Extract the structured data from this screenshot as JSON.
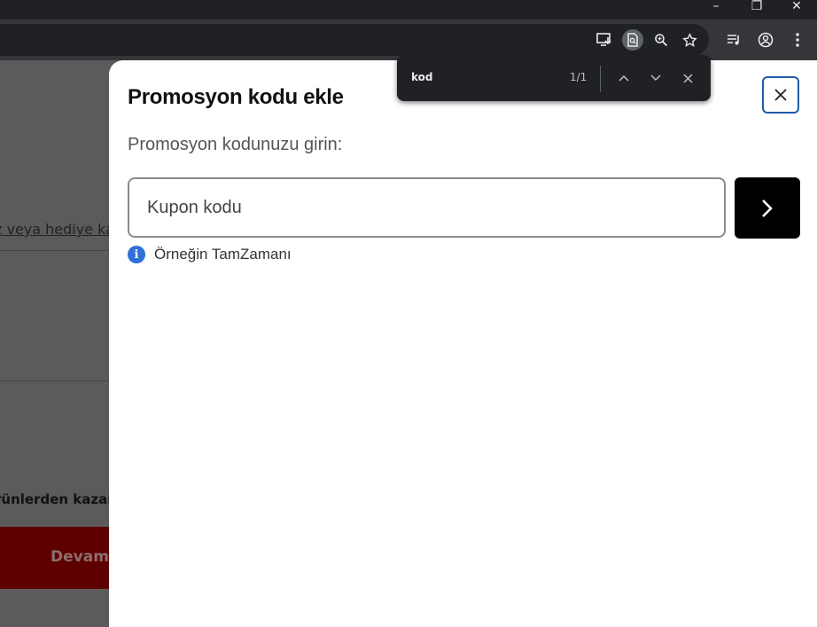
{
  "window": {
    "minimize_glyph": "–",
    "restore_glyph": "❐",
    "close_glyph": "✕"
  },
  "toolbar": {
    "icons": [
      "install-app-icon",
      "find-in-page-icon",
      "zoom-icon",
      "bookmark-star-icon",
      "media-controls-icon",
      "profile-icon",
      "menu-icon"
    ]
  },
  "background_page": {
    "link_text": "z veya hediye kar",
    "bold_text": "rünlerden kazan",
    "button_label": "Devam"
  },
  "modal": {
    "title": "Promosyon kodu ekle",
    "prompt": "Promosyon kodunuzu girin:",
    "input_placeholder": "Kupon kodu",
    "input_value": "",
    "info_glyph": "i",
    "hint": "Örneğin TamZamanı"
  },
  "find_bar": {
    "query": "kod",
    "count": "1/1"
  },
  "colors": {
    "modal_close_border": "#1e5ba8",
    "info_icon": "#2f6fd8",
    "submit_button": "#000000",
    "background_button": "#5e0000"
  }
}
